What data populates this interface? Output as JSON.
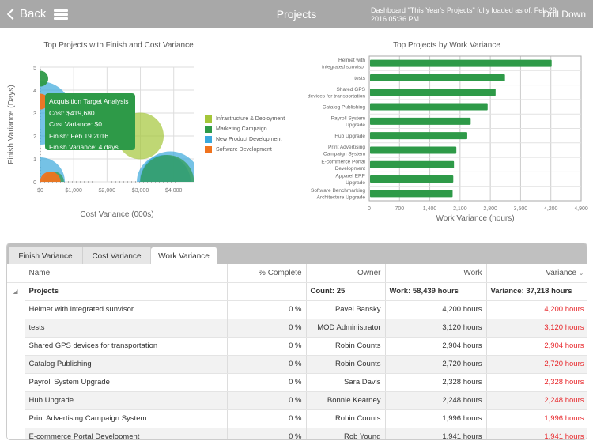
{
  "header": {
    "back_label": "Back",
    "title": "Projects",
    "status": "Dashboard \"This Year's Projects\" fully loaded as of: Feb 29 2016 05:36 PM",
    "drill_down_label": "Drill Down"
  },
  "colors": {
    "infrastructure": "#a4c639",
    "marketing": "#2e9a48",
    "new_product": "#3aa8dc",
    "software": "#f0731e",
    "bar": "#2e9a48",
    "negative_variance": "#e8282c"
  },
  "chart_data": [
    {
      "type": "scatter",
      "title": "Top Projects with Finish and Cost Variance",
      "xlabel": "Cost Variance (000s)",
      "ylabel": "Finish Variance (Days)",
      "xlim": [
        0,
        4600
      ],
      "ylim": [
        0,
        5
      ],
      "x_ticks": [
        "$0",
        "$1,000",
        "$2,000",
        "$3,000",
        "$4,000"
      ],
      "x_tick_values": [
        0,
        1000,
        2000,
        3000,
        4000
      ],
      "y_ticks": [
        "0",
        "1",
        "2",
        "3",
        "4",
        "5"
      ],
      "grid": true,
      "legend_position": "right",
      "legend": [
        "Infrastructure & Deployment",
        "Marketing Campaign",
        "New Product Development",
        "Software Development"
      ],
      "series": [
        {
          "name": "Infrastructure & Deployment",
          "points": [
            {
              "x": 3000,
              "y": 2,
              "size": 0.85
            }
          ]
        },
        {
          "name": "Marketing Campaign",
          "points": [
            {
              "x": 0,
              "y": 4.5,
              "size": 0.2
            },
            {
              "x": 400,
              "y": 0,
              "size": 0.3
            },
            {
              "x": 3800,
              "y": 0,
              "size": 1.0
            }
          ]
        },
        {
          "name": "New Product Development",
          "points": [
            {
              "x": 0,
              "y": 3,
              "size": 1.2
            },
            {
              "x": 0,
              "y": 0,
              "size": 0.9
            },
            {
              "x": 3900,
              "y": 0,
              "size": 1.15
            },
            {
              "x": 3700,
              "y": 0,
              "size": 1.0
            }
          ]
        },
        {
          "name": "Software Development",
          "points": [
            {
              "x": 0,
              "y": 3.5,
              "size": 0.2
            },
            {
              "x": 300,
              "y": 0,
              "size": 0.3
            }
          ]
        }
      ],
      "tooltip": {
        "title": "Acquisition Target Analysis",
        "lines": [
          "Cost: $419,680",
          "Cost Variance: $0",
          "Finish: Feb 19 2016",
          "Finish Variance: 4 days"
        ]
      }
    },
    {
      "type": "bar",
      "orientation": "horizontal",
      "title": "Top Projects by Work Variance",
      "xlabel": "Work Variance (hours)",
      "ylabel": "",
      "xlim": [
        0,
        4900
      ],
      "x_ticks": [
        "0",
        "700",
        "1,400",
        "2,100",
        "2,800",
        "3,500",
        "4,200",
        "4,900"
      ],
      "grid": true,
      "categories": [
        [
          "Helmet with",
          "integrated sunvisor"
        ],
        [
          "tests"
        ],
        [
          "Shared GPS",
          "devices for transportation"
        ],
        [
          "Catalog Publishing"
        ],
        [
          "Payroll System",
          "Upgrade"
        ],
        [
          "Hub Upgrade"
        ],
        [
          "Print Advertising",
          "Campaign System"
        ],
        [
          "E-commerce Portal",
          "Development"
        ],
        [
          "Apparel ERP",
          "Upgrade"
        ],
        [
          "Software Benchmarking",
          "Architecture Upgrade"
        ]
      ],
      "values": [
        4200,
        3120,
        2904,
        2720,
        2328,
        2248,
        1996,
        1941,
        1925,
        1910
      ]
    }
  ],
  "grid": {
    "tabs": [
      {
        "label": "Finish Variance",
        "active": false
      },
      {
        "label": "Cost Variance",
        "active": false
      },
      {
        "label": "Work Variance",
        "active": true
      }
    ],
    "columns": [
      "Name",
      "% Complete",
      "Owner",
      "Work",
      "Variance"
    ],
    "group": {
      "label": "Projects",
      "count": "Count: 25",
      "work": "Work: 58,439 hours",
      "variance": "Variance: 37,218 hours"
    },
    "rows": [
      {
        "name": "Helmet with integrated sunvisor",
        "complete": "0 %",
        "owner": "Pavel Bansky",
        "work": "4,200 hours",
        "variance": "4,200 hours"
      },
      {
        "name": "tests",
        "complete": "0 %",
        "owner": "MOD Administrator",
        "work": "3,120 hours",
        "variance": "3,120 hours"
      },
      {
        "name": "Shared GPS devices for transportation",
        "complete": "0 %",
        "owner": "Robin Counts",
        "work": "2,904 hours",
        "variance": "2,904 hours"
      },
      {
        "name": "Catalog Publishing",
        "complete": "0 %",
        "owner": "Robin Counts",
        "work": "2,720 hours",
        "variance": "2,720 hours"
      },
      {
        "name": "Payroll System Upgrade",
        "complete": "0 %",
        "owner": "Sara Davis",
        "work": "2,328 hours",
        "variance": "2,328 hours"
      },
      {
        "name": "Hub Upgrade",
        "complete": "0 %",
        "owner": "Bonnie Kearney",
        "work": "2,248 hours",
        "variance": "2,248 hours"
      },
      {
        "name": "Print Advertising Campaign System",
        "complete": "0 %",
        "owner": "Robin Counts",
        "work": "1,996 hours",
        "variance": "1,996 hours"
      },
      {
        "name": "E-commerce Portal Development",
        "complete": "0 %",
        "owner": "Rob Young",
        "work": "1,941 hours",
        "variance": "1,941 hours"
      }
    ]
  }
}
